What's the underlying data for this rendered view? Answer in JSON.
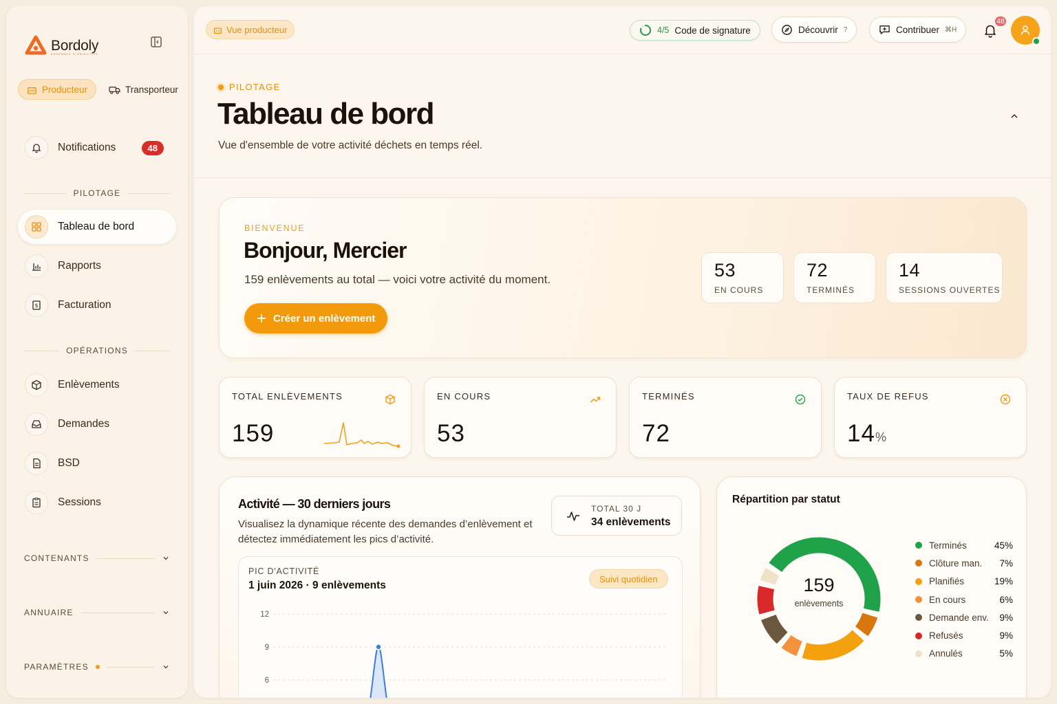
{
  "brand": {
    "name": "Bordoly",
    "tagline": "ENSEMBLE D'OBJECTIFS"
  },
  "sidebar": {
    "roles": [
      {
        "label": "Producteur",
        "active": true
      },
      {
        "label": "Transporteur",
        "active": false
      }
    ],
    "notifications": {
      "label": "Notifications",
      "count": "48"
    },
    "section_pilotage": "PILOTAGE",
    "pilotage_items": [
      {
        "label": "Tableau de bord",
        "icon": "grid-icon",
        "active": true
      },
      {
        "label": "Rapports",
        "icon": "bar-chart-icon"
      },
      {
        "label": "Facturation",
        "icon": "invoice-icon"
      }
    ],
    "section_operations": "OPÉRATIONS",
    "operations_items": [
      {
        "label": "Enlèvements",
        "icon": "box-icon"
      },
      {
        "label": "Demandes",
        "icon": "inbox-icon"
      },
      {
        "label": "BSD",
        "icon": "document-icon"
      },
      {
        "label": "Sessions",
        "icon": "clipboard-icon"
      }
    ],
    "collapsible_sections": [
      "CONTENANTS",
      "ANNUAIRE",
      "PARAMÈTRES"
    ]
  },
  "topbar": {
    "view_label": "Vue producteur",
    "signature": {
      "fraction": "4/5",
      "label": "Code de signature"
    },
    "discover": {
      "label": "Découvrir",
      "shortcut": "?"
    },
    "contribute": {
      "label": "Contribuer",
      "shortcut": "⌘H"
    },
    "bell_count": "48"
  },
  "page": {
    "eyebrow": "PILOTAGE",
    "title": "Tableau de bord",
    "subtitle": "Vue d'ensemble de votre activité déchets en temps réel."
  },
  "welcome": {
    "eyebrow": "BIENVENUE",
    "title": "Bonjour, Mercier",
    "subtitle": "159 enlèvements au total — voici votre activité du moment.",
    "cta": "Créer un enlèvement",
    "stats": [
      {
        "value": "53",
        "label": "EN COURS"
      },
      {
        "value": "72",
        "label": "TERMINÉS"
      },
      {
        "value": "14",
        "label": "SESSIONS OUVERTES"
      }
    ]
  },
  "kpis": [
    {
      "label": "TOTAL ENLÈVEMENTS",
      "value": "159",
      "icon": "box-icon",
      "color": "#f29a0c"
    },
    {
      "label": "EN COURS",
      "value": "53",
      "icon": "trending-up-icon",
      "color": "#f29a0c"
    },
    {
      "label": "TERMINÉS",
      "value": "72",
      "icon": "check-circle-icon",
      "color": "#22a04a"
    },
    {
      "label": "TAUX DE REFUS",
      "value": "14",
      "unit": "%",
      "icon": "x-circle-icon",
      "color": "#f29a0c"
    }
  ],
  "activity": {
    "title": "Activité — 30 derniers jours",
    "description": "Visualisez la dynamique récente des demandes d’enlèvement et détectez immédiatement les pics d’activité.",
    "total_label": "TOTAL 30 J",
    "total_value": "34 enlèvements",
    "peak_label": "PIC D'ACTIVITÉ",
    "peak_value": "1 juin 2026 · 9 enlèvements",
    "badge": "Suivi quotidien"
  },
  "chart_data": {
    "type": "area",
    "y_ticks": [
      12,
      9,
      6
    ],
    "ylim": [
      0,
      12
    ],
    "peak": {
      "label": "1 juin 2026",
      "y": 9
    }
  },
  "status_breakdown": {
    "title": "Répartition par statut",
    "total": "159",
    "total_label": "enlèvements",
    "items": [
      {
        "label": "Terminés",
        "pct": "45%",
        "value": 45,
        "color": "#1fa24a"
      },
      {
        "label": "Clôture man.",
        "pct": "7%",
        "value": 7,
        "color": "#d9770f"
      },
      {
        "label": "Planifiés",
        "pct": "19%",
        "value": 19,
        "color": "#f4a10f"
      },
      {
        "label": "En cours",
        "pct": "6%",
        "value": 6,
        "color": "#f3913c"
      },
      {
        "label": "Demande env.",
        "pct": "9%",
        "value": 9,
        "color": "#6b5640"
      },
      {
        "label": "Refusés",
        "pct": "9%",
        "value": 9,
        "color": "#d8282a"
      },
      {
        "label": "Annulés",
        "pct": "5%",
        "value": 5,
        "color": "#efe2c8"
      }
    ]
  }
}
